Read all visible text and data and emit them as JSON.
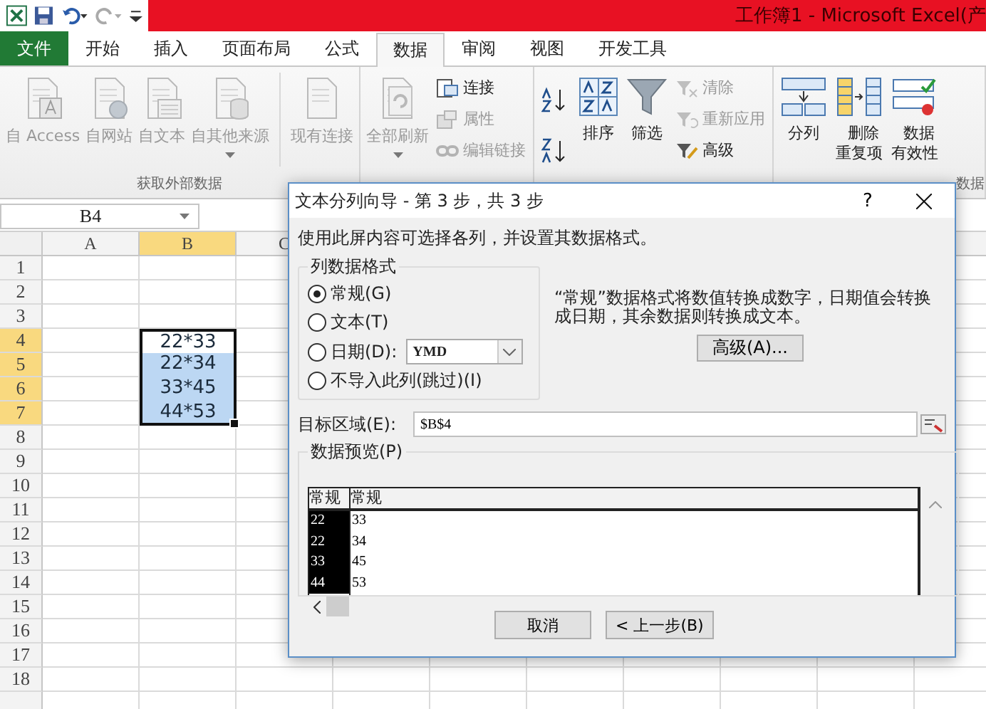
{
  "window": {
    "title": "工作簿1 - Microsoft Excel(产"
  },
  "tabs": [
    {
      "label": "文件",
      "selected": false,
      "kind": "file"
    },
    {
      "label": "开始",
      "selected": false,
      "kind": "tab"
    },
    {
      "label": "插入",
      "selected": false,
      "kind": "tab"
    },
    {
      "label": "页面布局",
      "selected": false,
      "kind": "tab"
    },
    {
      "label": "公式",
      "selected": false,
      "kind": "tab"
    },
    {
      "label": "数据",
      "selected": true,
      "kind": "tab"
    },
    {
      "label": "审阅",
      "selected": false,
      "kind": "tab"
    },
    {
      "label": "视图",
      "selected": false,
      "kind": "tab"
    },
    {
      "label": "开发工具",
      "selected": false,
      "kind": "tab"
    }
  ],
  "ribbon": {
    "groups": [
      {
        "label": "获取外部数据",
        "items": [
          {
            "kind": "large",
            "label": "自 Access",
            "disabled": true
          },
          {
            "kind": "large",
            "label": "自网站",
            "disabled": true
          },
          {
            "kind": "large",
            "label": "自文本",
            "disabled": true
          },
          {
            "kind": "large",
            "label": "自其他来源",
            "disabled": true,
            "dropdown": true
          },
          {
            "kind": "separator"
          },
          {
            "kind": "large",
            "label": "现有连接",
            "disabled": true
          }
        ]
      },
      {
        "items": [
          {
            "kind": "large",
            "label": "全部刷新",
            "disabled": true,
            "dropdown": true
          },
          {
            "kind": "stack",
            "items": [
              {
                "label": "连接",
                "disabled": false
              },
              {
                "label": "属性",
                "disabled": true
              },
              {
                "label": "编辑链接",
                "disabled": true
              }
            ]
          }
        ]
      },
      {
        "items": [
          {
            "kind": "sort_pair"
          },
          {
            "kind": "large",
            "label": "排序",
            "disabled": false
          },
          {
            "kind": "large",
            "label": "筛选",
            "disabled": false
          },
          {
            "kind": "stack",
            "items": [
              {
                "label": "清除",
                "disabled": true
              },
              {
                "label": "重新应用",
                "disabled": true
              },
              {
                "label": "高级",
                "disabled": false
              }
            ]
          }
        ]
      },
      {
        "label": "数据",
        "items": [
          {
            "kind": "large",
            "label": "分列",
            "disabled": false
          },
          {
            "kind": "large",
            "label": "删除重复项",
            "disabled": false,
            "wrap": true
          },
          {
            "kind": "large",
            "label": "数据有效性",
            "disabled": false,
            "wrap": true
          }
        ]
      }
    ]
  },
  "name_box": "B4",
  "sheet": {
    "columns": [
      {
        "label": "A",
        "selected": false
      },
      {
        "label": "B",
        "selected": true
      },
      {
        "label": "C",
        "selected": false
      }
    ],
    "rows": [
      {
        "label": "1",
        "selected": false
      },
      {
        "label": "2",
        "selected": false
      },
      {
        "label": "3",
        "selected": false
      },
      {
        "label": "4",
        "selected": true
      },
      {
        "label": "5",
        "selected": true
      },
      {
        "label": "6",
        "selected": true
      },
      {
        "label": "7",
        "selected": true
      },
      {
        "label": "8",
        "selected": false
      },
      {
        "label": "9",
        "selected": false
      },
      {
        "label": "10",
        "selected": false
      },
      {
        "label": "11",
        "selected": false
      },
      {
        "label": "12",
        "selected": false
      },
      {
        "label": "13",
        "selected": false
      },
      {
        "label": "14",
        "selected": false
      },
      {
        "label": "15",
        "selected": false
      },
      {
        "label": "16",
        "selected": false
      },
      {
        "label": "17",
        "selected": false
      },
      {
        "label": "18",
        "selected": false
      }
    ],
    "range_cells": [
      {
        "text": "22*33",
        "selected": false
      },
      {
        "text": "22*34",
        "selected": true
      },
      {
        "text": "33*45",
        "selected": true
      },
      {
        "text": "44*53",
        "selected": true
      }
    ]
  },
  "dialog": {
    "title": "文本分列向导 - 第 3 步，共 3 步",
    "help": "?",
    "instruction": "使用此屏内容可选择各列，并设置其数据格式。",
    "format_group": {
      "label": "列数据格式",
      "options": [
        {
          "label": "常规(G)",
          "selected": true,
          "kind": "plain"
        },
        {
          "label": "文本(T)",
          "selected": false,
          "kind": "plain"
        },
        {
          "label": "日期(D):",
          "selected": false,
          "kind": "date",
          "value": "YMD"
        },
        {
          "label": "不导入此列(跳过)(I)",
          "selected": false,
          "kind": "plain"
        }
      ]
    },
    "description": "“常规”数据格式将数值转换成数字，日期值会转换成日期，其余数据则转换成文本。",
    "advanced_button": "高级(A)...",
    "destination": {
      "label": "目标区域(E):",
      "value": "$B$4"
    },
    "preview": {
      "label": "数据预览(P)",
      "columns": [
        {
          "header": "常规",
          "selected": true,
          "values": [
            "22",
            "22",
            "33",
            "44"
          ]
        },
        {
          "header": "常规",
          "selected": false,
          "values": [
            "33",
            "34",
            "45",
            "53"
          ]
        }
      ]
    },
    "buttons": [
      "取消",
      "< 上一步(B)"
    ]
  }
}
